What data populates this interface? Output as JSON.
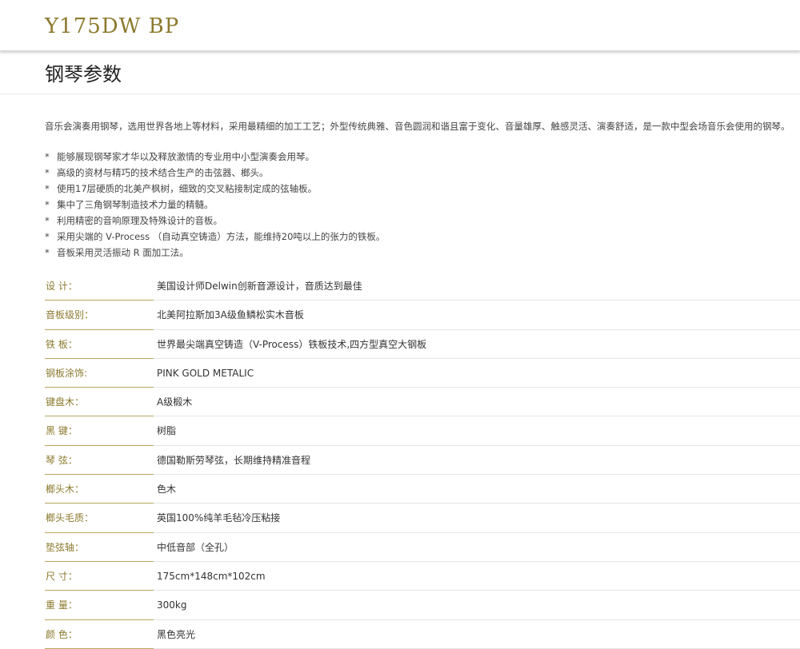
{
  "header": {
    "model": "Y175DW BP"
  },
  "section": {
    "title": "钢琴参数"
  },
  "intro": "音乐会演奏用钢琴，选用世界各地上等材料，采用最精细的加工工艺；外型传统典雅、音色圆润和谐且富于变化、音量雄厚、触感灵活、演奏舒适，是一款中型会场音乐会使用的钢琴。",
  "features": {
    "bullet": "*",
    "items": [
      "能够展现钢琴家才华以及释放激情的专业用中小型演奏会用琴。",
      "高级的资材与精巧的技术结合生产的击弦器、榔头。",
      "使用17层硬质的北美产枫树，细致的交叉粘接制定成的弦轴板。",
      "集中了三角钢琴制造技术力量的精髓。",
      "利用精密的音响原理及特殊设计的音板。",
      "采用尖端的 V-Process （自动真空铸造）方法，能维持20吨以上的张力的铁板。",
      "音板采用灵活振动 R 面加工法。"
    ]
  },
  "specs": [
    {
      "label": "设 计：",
      "value": "美国设计师Delwin创新音源设计，音质达到最佳"
    },
    {
      "label": "音板级别：",
      "value": "北美阿拉斯加3A级鱼鳞松实木音板"
    },
    {
      "label": "铁 板：",
      "value": "世界最尖端真空铸造（V-Process）铁板技术,四方型真空大钢板"
    },
    {
      "label": "钢板涂饰:",
      "value": "PINK GOLD METALIC"
    },
    {
      "label": "键盘木：",
      "value": "A级椴木"
    },
    {
      "label": "黑 键：",
      "value": "树脂"
    },
    {
      "label": "琴 弦：",
      "value": "德国勒斯劳琴弦，长期维持精准音程"
    },
    {
      "label": "榔头木：",
      "value": "色木"
    },
    {
      "label": "榔头毛质：",
      "value": "英国100%纯羊毛毡冷压粘接"
    },
    {
      "label": "垫弦轴：",
      "value": "中低音部（全孔）"
    },
    {
      "label": "尺 寸：",
      "value": "175cm*148cm*102cm"
    },
    {
      "label": "重 量：",
      "value": "300kg"
    },
    {
      "label": "颜 色：",
      "value": "黑色亮光"
    }
  ],
  "colors": {
    "accent_gold": "#8c7a2e",
    "text": "#333333"
  }
}
